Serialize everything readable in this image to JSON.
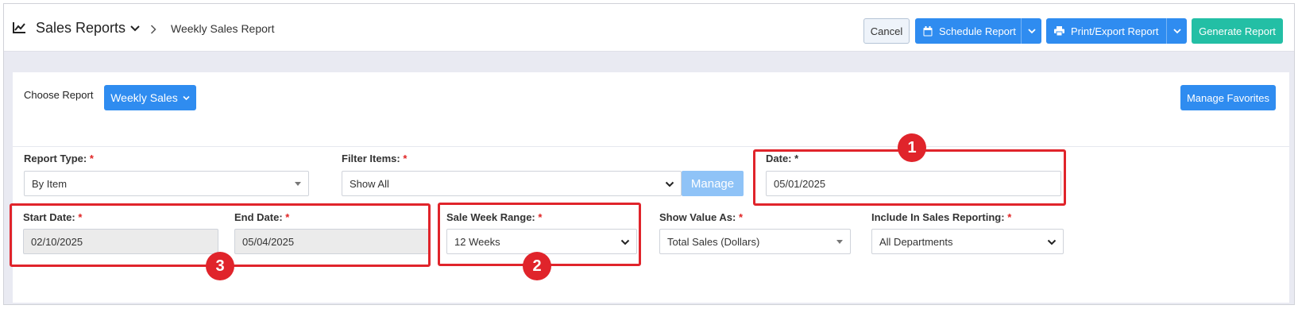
{
  "header": {
    "app_title": "Sales Reports",
    "breadcrumb": "Weekly Sales Report",
    "buttons": {
      "cancel": "Cancel",
      "schedule": "Schedule Report",
      "print_export": "Print/Export Report",
      "generate": "Generate Report"
    }
  },
  "report_chooser": {
    "label": "Choose Report",
    "selected": "Weekly Sales",
    "manage_favorites": "Manage Favorites"
  },
  "form": {
    "report_type": {
      "label": "Report Type:",
      "required": "*",
      "value": "By Item"
    },
    "filter_items": {
      "label": "Filter Items:",
      "required": "*",
      "value": "Show All",
      "manage_button": "Manage"
    },
    "date": {
      "label": "Date: *",
      "value": "05/01/2025"
    },
    "start_date": {
      "label": "Start Date:",
      "required": "*",
      "value": "02/10/2025"
    },
    "end_date": {
      "label": "End Date:",
      "required": "*",
      "value": "05/04/2025"
    },
    "sale_week_range": {
      "label": "Sale Week Range:",
      "required": "*",
      "value": "12 Weeks"
    },
    "show_value_as": {
      "label": "Show Value As:",
      "required": "*",
      "value": "Total Sales (Dollars)"
    },
    "include_in_sales": {
      "label": "Include In Sales Reporting:",
      "required": "*",
      "value": "All Departments"
    }
  },
  "annotations": {
    "badge_1": "1",
    "badge_2": "2",
    "badge_3": "3",
    "highlight_color": "#e0242b"
  },
  "colors": {
    "primary": "#2f8cf0",
    "generate": "#23bfa5",
    "manage_disabled": "#8fc3f7",
    "required": "#e02424"
  },
  "icons": {
    "title": "line-chart-icon",
    "schedule": "calendar-icon",
    "print": "printer-icon"
  }
}
